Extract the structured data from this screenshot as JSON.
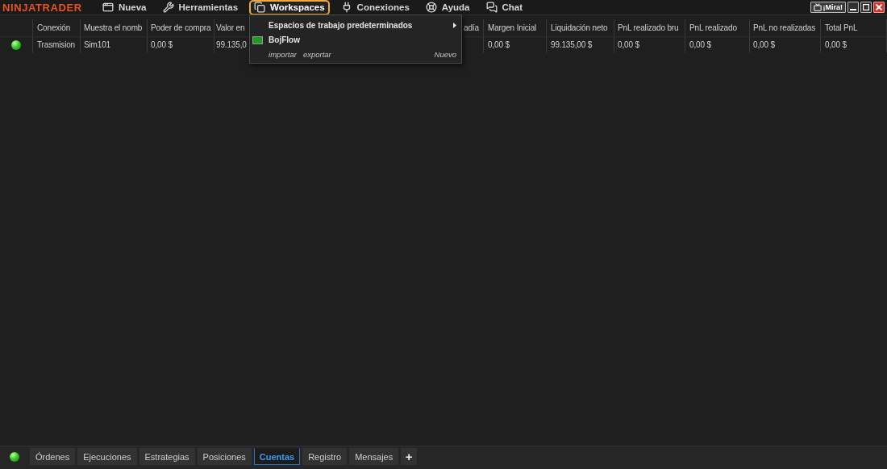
{
  "app": {
    "logo": "NINJATRADER"
  },
  "menu_bar": {
    "items": [
      {
        "label": "Nueva",
        "selected": false
      },
      {
        "label": "Herramientas",
        "selected": false
      },
      {
        "label": "Workspaces",
        "selected": true
      },
      {
        "label": "Conexiones",
        "selected": false
      },
      {
        "label": "Ayuda",
        "selected": false
      },
      {
        "label": "Chat",
        "selected": false
      }
    ]
  },
  "window_controls": {
    "watch_button": "¡Mira!"
  },
  "workspaces_menu": {
    "items": [
      {
        "kind": "submenu",
        "label": "Espacios de trabajo predeterminados"
      },
      {
        "kind": "workspace",
        "label": "BojFlow"
      }
    ],
    "footer": {
      "links": [
        "importar",
        "exportar"
      ],
      "new": "Nuevo"
    }
  },
  "accounts_table": {
    "columns": [
      "Conexión",
      "Muestra el nomb",
      "Poder de compra",
      "Valor en",
      "adía",
      "Margen Inicial",
      "Liquidación neto",
      "PnL realizado bru",
      "PnL realizado",
      "PnL no realizadas",
      "Total PnL"
    ],
    "rows": [
      {
        "connected": true,
        "cells": [
          "Trasmision",
          "Sim101",
          "0,00 $",
          "99.135,0",
          null,
          "0,00 $",
          "99.135,00 $",
          "0,00 $",
          "0,00 $",
          "0,00 $",
          "0,00 $"
        ]
      }
    ]
  },
  "bottom_tabs": {
    "connected": true,
    "tabs": [
      {
        "label": "Órdenes",
        "selected": false
      },
      {
        "label": "Ejecuciones",
        "selected": false
      },
      {
        "label": "Estrategias",
        "selected": false
      },
      {
        "label": "Posiciones",
        "selected": false
      },
      {
        "label": "Cuentas",
        "selected": true
      },
      {
        "label": "Registro",
        "selected": false
      },
      {
        "label": "Mensajes",
        "selected": false
      }
    ],
    "add": "+"
  }
}
